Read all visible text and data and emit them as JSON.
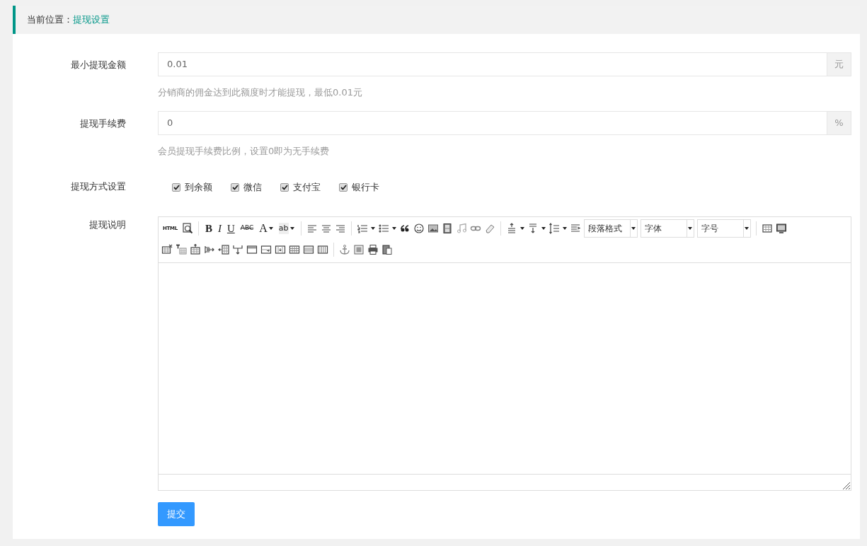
{
  "breadcrumb": {
    "label": "当前位置：",
    "current": "提现设置"
  },
  "fields": [
    {
      "label": "最小提现金额",
      "value": "0.01",
      "addon": "元",
      "help": "分销商的佣金达到此额度时才能提现，最低0.01元"
    },
    {
      "label": "提现手续费",
      "value": "0",
      "addon": "%",
      "help": "会员提现手续费比例，设置0即为无手续费"
    }
  ],
  "methods": {
    "label": "提现方式设置",
    "options": [
      {
        "label": "到余额",
        "checked": true
      },
      {
        "label": "微信",
        "checked": true
      },
      {
        "label": "支付宝",
        "checked": true
      },
      {
        "label": "银行卡",
        "checked": true
      }
    ]
  },
  "editor": {
    "label": "提现说明",
    "toolbar": [
      [
        {
          "kind": "text",
          "label": "HTML"
        },
        {
          "kind": "icon"
        },
        {
          "kind": "separator"
        },
        {
          "kind": "text",
          "label": "B"
        },
        {
          "kind": "text",
          "label": "I"
        },
        {
          "kind": "text",
          "label": "U"
        },
        {
          "kind": "text",
          "label": "ABC"
        },
        {
          "kind": "text",
          "label": "A",
          "dropdown": true
        },
        {
          "kind": "text",
          "label": "ab",
          "dropdown": true
        },
        {
          "kind": "separator"
        },
        {
          "kind": "icon"
        },
        {
          "kind": "icon"
        },
        {
          "kind": "icon"
        },
        {
          "kind": "separator"
        },
        {
          "kind": "icon",
          "dropdown": true
        },
        {
          "kind": "icon",
          "dropdown": true
        },
        {
          "kind": "icon"
        },
        {
          "kind": "icon"
        },
        {
          "kind": "icon"
        },
        {
          "kind": "icon"
        },
        {
          "kind": "icon"
        },
        {
          "kind": "icon"
        },
        {
          "kind": "icon"
        },
        {
          "kind": "separator"
        },
        {
          "kind": "icon",
          "dropdown": true
        },
        {
          "kind": "icon",
          "dropdown": true
        },
        {
          "kind": "icon",
          "dropdown": true
        },
        {
          "kind": "icon"
        },
        {
          "kind": "select",
          "label": "段落格式"
        },
        {
          "kind": "select",
          "label": "字体"
        },
        {
          "kind": "select",
          "label": "字号"
        },
        {
          "kind": "separator"
        },
        {
          "kind": "icon"
        },
        {
          "kind": "icon"
        }
      ],
      [
        {
          "kind": "icon"
        },
        {
          "kind": "icon"
        },
        {
          "kind": "icon"
        },
        {
          "kind": "icon"
        },
        {
          "kind": "icon"
        },
        {
          "kind": "icon"
        },
        {
          "kind": "icon"
        },
        {
          "kind": "icon"
        },
        {
          "kind": "icon"
        },
        {
          "kind": "icon"
        },
        {
          "kind": "icon"
        },
        {
          "kind": "icon"
        },
        {
          "kind": "separator"
        },
        {
          "kind": "icon"
        },
        {
          "kind": "icon"
        },
        {
          "kind": "icon"
        },
        {
          "kind": "icon"
        }
      ]
    ]
  },
  "submit": "提交"
}
